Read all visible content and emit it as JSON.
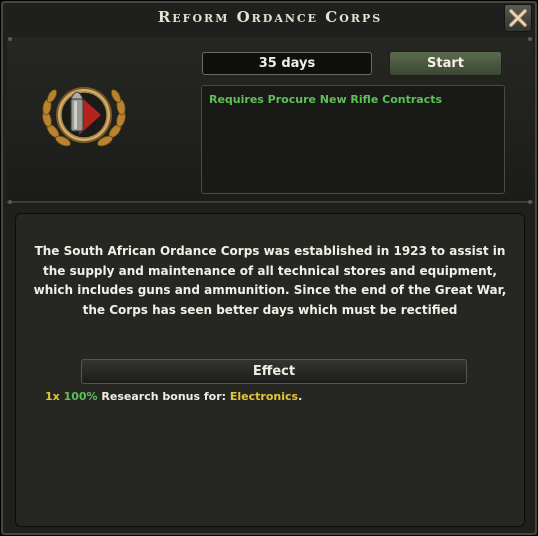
{
  "window": {
    "title": "Reform Ordance Corps"
  },
  "close_icon": "close-x-icon",
  "emblem_icon": "ordnance-shell-laurel-emblem",
  "duration": "35 days",
  "start_label": "Start",
  "requirement": "Requires Procure New Rifle Contracts",
  "description": [
    "The South African Ordance Corps was established in 1923 to assist in",
    "the supply and maintenance of all technical stores and equipment,",
    "which includes guns and ammunition. Since the end of the Great War,",
    "the Corps has seen better days which must be rectified"
  ],
  "effect": {
    "heading": "Effect",
    "multiplier": "1x",
    "percent": "100%",
    "text": "Research bonus for:",
    "target": "Electronics",
    "end": "."
  },
  "colors": {
    "accent_green": "#5fbf59",
    "gold": "#e6c534"
  }
}
